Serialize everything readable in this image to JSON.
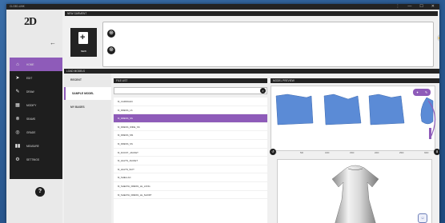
{
  "window": {
    "title": "CLO3D-LINK",
    "controls": [
      "⋮",
      "—",
      "☐",
      "✕"
    ]
  },
  "logo": {
    "text": "2D"
  },
  "nav": {
    "items": [
      {
        "label": "HOME",
        "icon": "home-icon",
        "glyph": "⌂",
        "active": true
      },
      {
        "label": "EDIT",
        "icon": "cursor-icon",
        "glyph": "➤",
        "active": false
      },
      {
        "label": "DRAW",
        "icon": "pencil-icon",
        "glyph": "✎",
        "active": false
      },
      {
        "label": "MODIFY",
        "icon": "grid-icon",
        "glyph": "▦",
        "active": false
      },
      {
        "label": "SEAMS",
        "icon": "seams-icon",
        "glyph": "⊗",
        "active": false
      },
      {
        "label": "GRADE",
        "icon": "grade-icon",
        "glyph": "◎",
        "active": false
      },
      {
        "label": "MEASURE",
        "icon": "measure-icon",
        "glyph": "▮▮",
        "active": false
      },
      {
        "label": "SETTINGS",
        "icon": "settings-icon",
        "glyph": "⚙",
        "active": false
      }
    ],
    "help": "?"
  },
  "new_garment": {
    "header": "NEW GARMENT",
    "new_label": "NEW"
  },
  "load_models": {
    "header": "LOAD MODELS",
    "tabs": [
      "RECENT",
      "SAMPLE MODEL",
      "MY BASES"
    ],
    "active_tab": 1
  },
  "file_list": {
    "header": "FILE LIST",
    "search_placeholder": "",
    "files": [
      "M_CARDIGAN",
      "M_DRESS_LS",
      "M_DRESS_SS",
      "M_DRESS_WIDE_SS",
      "M_DRESS_MS",
      "M_DRESS_SS",
      "M_DUCKT_JACKET",
      "M_HALTN_JACKET",
      "M_HALTN_SUIT",
      "M_SHELLAC",
      "M_SHEATH_DRESS_LE_LONG",
      "M_SHEATH_DRESS_LE_SHORT"
    ],
    "selected_index": 2
  },
  "preview": {
    "header": "MODEL PREVIEW",
    "axis_ticks": [
      "0",
      "500",
      "1000",
      "1500",
      "2000",
      "2500",
      "3000"
    ],
    "pattern_color": "#5b8bd6",
    "accent_color": "#8e5bb9"
  }
}
